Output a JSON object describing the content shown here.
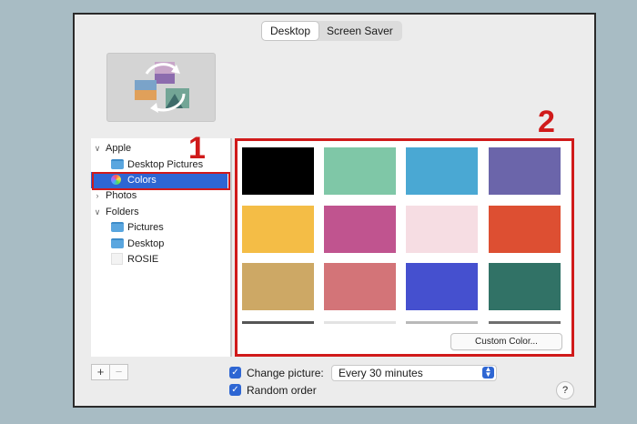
{
  "tabs": [
    "Desktop",
    "Screen Saver"
  ],
  "sidebar": {
    "apple": "Apple",
    "desktop_pictures": "Desktop Pictures",
    "colors": "Colors",
    "photos": "Photos",
    "folders": "Folders",
    "pictures": "Pictures",
    "desktop": "Desktop",
    "rosie": "ROSIE"
  },
  "swatches": [
    "#000000",
    "#7fc7a7",
    "#4aa8d3",
    "#6b65aa",
    "#f4bd46",
    "#c0548f",
    "#f6dde3",
    "#dd4f32",
    "#cda865",
    "#d37478",
    "#4550cf",
    "#317266"
  ],
  "partial_swatches": [
    "#555555",
    "#e3e3e3",
    "#b9b9b9",
    "#6f6f6f"
  ],
  "custom_color_label": "Custom Color...",
  "bottom": {
    "add": "+",
    "remove": "−",
    "change_picture": "Change picture:",
    "interval": "Every 30 minutes",
    "random_order": "Random order",
    "help": "?"
  },
  "annotations": [
    "1",
    "2"
  ]
}
